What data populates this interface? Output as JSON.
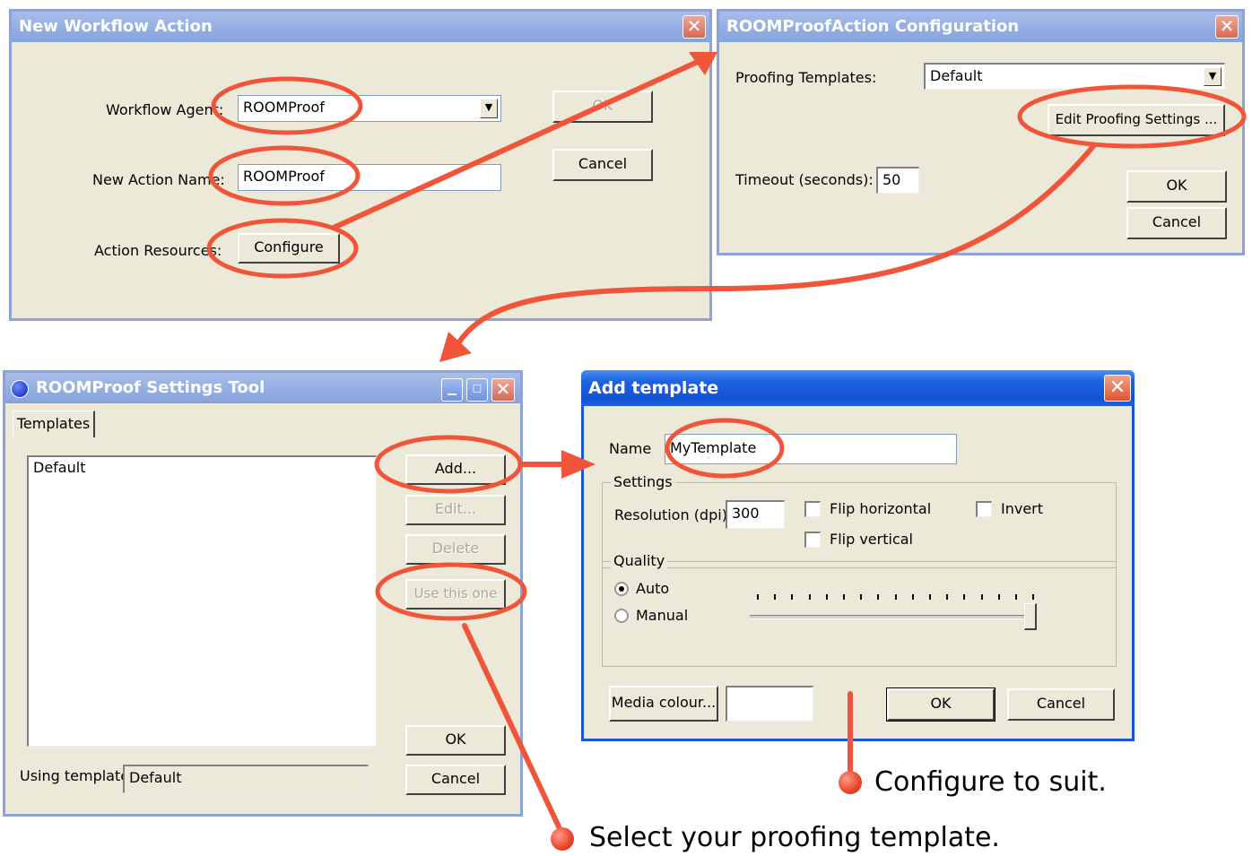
{
  "new_workflow_action": {
    "title": "New Workflow Action",
    "workflow_agent_label": "Workflow Agent:",
    "workflow_agent_value": "ROOMProof",
    "new_action_name_label": "New Action Name:",
    "new_action_name_value": "ROOMProof",
    "action_resources_label": "Action Resources:",
    "configure_label": "Configure",
    "ok_label": "OK",
    "cancel_label": "Cancel"
  },
  "roomproof_config": {
    "title": "ROOMProofAction Configuration",
    "proofing_templates_label": "Proofing Templates:",
    "proofing_templates_value": "Default",
    "edit_settings_label": "Edit Proofing Settings ...",
    "timeout_label": "Timeout (seconds):",
    "timeout_value": "50",
    "ok_label": "OK",
    "cancel_label": "Cancel"
  },
  "settings_tool": {
    "title": "ROOMProof Settings Tool",
    "tab_label": "Templates",
    "templates": [
      "Default"
    ],
    "add_label": "Add...",
    "edit_label": "Edit...",
    "delete_label": "Delete",
    "use_label": "Use this one",
    "ok_label": "OK",
    "cancel_label": "Cancel",
    "using_template_label": "Using template",
    "using_template_value": "Default"
  },
  "add_template": {
    "title": "Add template",
    "name_label": "Name",
    "name_value": "MyTemplate",
    "settings_legend": "Settings",
    "resolution_label": "Resolution (dpi)",
    "resolution_value": "300",
    "flip_horizontal_label": "Flip horizontal",
    "flip_vertical_label": "Flip vertical",
    "invert_label": "Invert",
    "quality_legend": "Quality",
    "auto_label": "Auto",
    "manual_label": "Manual",
    "quality_selected": "Auto",
    "media_colour_label": "Media colour...",
    "ok_label": "OK",
    "cancel_label": "Cancel"
  },
  "callouts": {
    "configure_to_suit": "Configure to suit.",
    "select_template": "Select your proofing template."
  },
  "colors": {
    "annotation": "#f0553a",
    "dialog_face": "#ece9d8"
  }
}
